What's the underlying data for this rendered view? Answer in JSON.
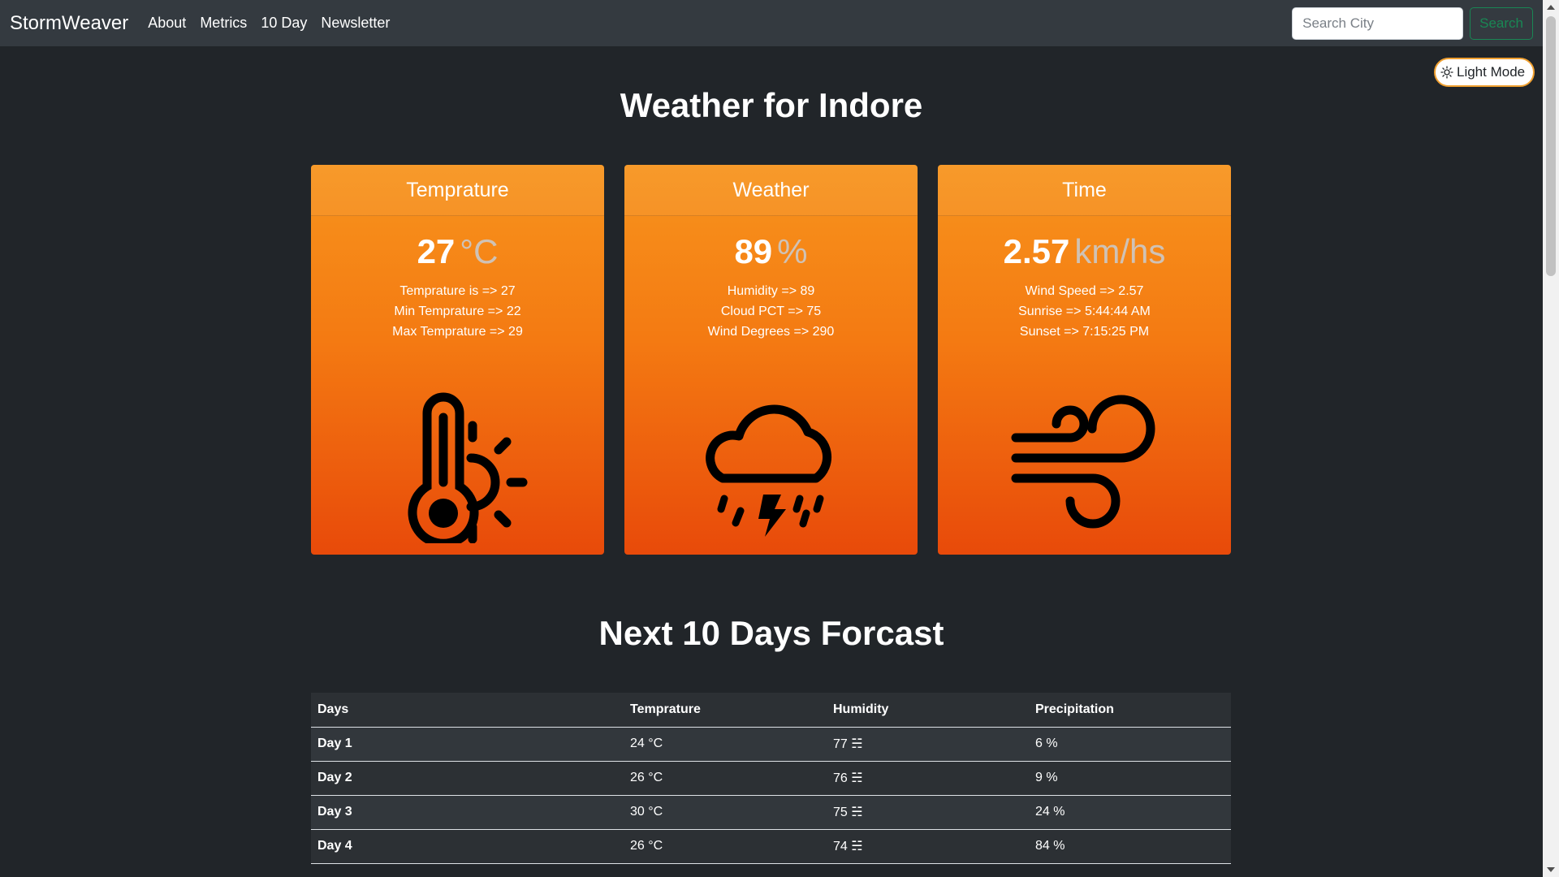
{
  "navbar": {
    "brand": "StormWeaver",
    "links": [
      "About",
      "Metrics",
      "10 Day",
      "Newsletter"
    ],
    "search_placeholder": "Search City",
    "search_button": "Search"
  },
  "mode_toggle": {
    "label": "Light Mode",
    "icon": "sun-icon"
  },
  "title": "Weather for Indore",
  "cards": [
    {
      "header": "Temprature",
      "value": "27",
      "unit": "°C",
      "lines": [
        "Temprature is => 27",
        "Min Temprature => 22",
        "Max Temprature => 29"
      ],
      "icon": "thermometer-sun-icon"
    },
    {
      "header": "Weather",
      "value": "89",
      "unit": "%",
      "lines": [
        "Humidity => 89",
        "Cloud PCT => 75",
        "Wind Degrees => 290"
      ],
      "icon": "storm-cloud-icon"
    },
    {
      "header": "Time",
      "value": "2.57",
      "unit": "km/hs",
      "lines": [
        "Wind Speed => 2.57",
        "Sunrise => 5:44:44 AM",
        "Sunset => 7:15:25 PM"
      ],
      "icon": "wind-icon"
    }
  ],
  "forecast": {
    "title": "Next 10 Days Forcast",
    "columns": [
      "Days",
      "Temprature",
      "Humidity",
      "Precipitation"
    ],
    "rows": [
      [
        "Day 1",
        "24 °C",
        "77 ☵",
        "6 %"
      ],
      [
        "Day 2",
        "26 °C",
        "76 ☵",
        "9 %"
      ],
      [
        "Day 3",
        "30 °C",
        "75 ☵",
        "24 %"
      ],
      [
        "Day 4",
        "26 °C",
        "74 ☵",
        "84 %"
      ]
    ]
  },
  "colors": {
    "background": "#212529",
    "navbar": "#343a40",
    "card_top": "#f7941d",
    "card_bottom": "#e84a0a",
    "search_green": "#198754"
  }
}
